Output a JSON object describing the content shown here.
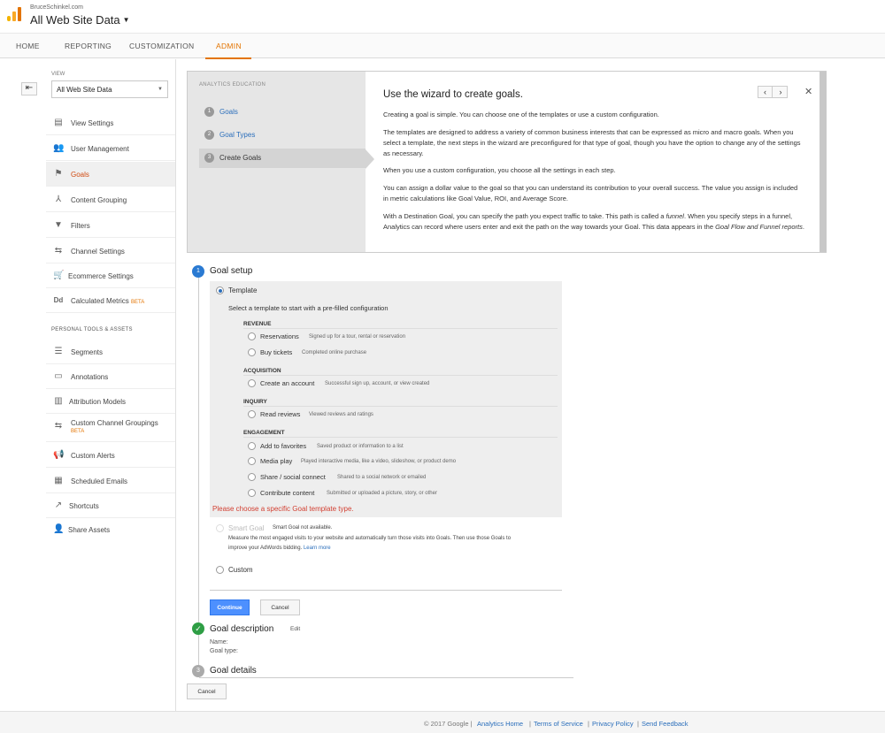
{
  "header": {
    "account_email": "BruceSchinkel.com",
    "property": "All Web Site Data",
    "caret": "▼"
  },
  "tabs": [
    "HOME",
    "REPORTING",
    "CUSTOMIZATION",
    "ADMIN"
  ],
  "sidebar": {
    "back": "⇤",
    "view_label": "VIEW",
    "view_value": "All Web Site Data",
    "view_caret": "▼",
    "items": [
      {
        "label": "View Settings",
        "icon": "document-icon"
      },
      {
        "label": "User Management",
        "icon": "users-icon"
      },
      {
        "label": "Goals",
        "icon": "flag-icon"
      },
      {
        "label": "Content Grouping",
        "icon": "person-icon"
      },
      {
        "label": "Filters",
        "icon": "filter-icon"
      },
      {
        "label": "Channel Settings",
        "icon": "channel-icon"
      },
      {
        "label": "Ecommerce Settings",
        "icon": "cart-icon"
      },
      {
        "label": "Calculated Metrics",
        "beta": "BETA",
        "icon": "dd-icon"
      }
    ],
    "personal_head": "PERSONAL TOOLS & ASSETS",
    "personal_items": [
      {
        "label": "Segments",
        "icon": "segments-icon"
      },
      {
        "label": "Annotations",
        "icon": "annotation-icon"
      },
      {
        "label": "Attribution Models",
        "icon": "bar-chart-icon"
      },
      {
        "label": "Custom Channel Groupings",
        "beta": "BETA",
        "icon": "channel-icon"
      },
      {
        "label": "Custom Alerts",
        "icon": "megaphone-icon"
      },
      {
        "label": "Scheduled Emails",
        "icon": "calendar-icon"
      },
      {
        "label": "Shortcuts",
        "icon": "shortcut-icon"
      },
      {
        "label": "Share Assets",
        "icon": "share-icon"
      }
    ]
  },
  "education": {
    "heading": "ANALYTICS EDUCATION",
    "steps": [
      {
        "num": "1",
        "label": "Goals"
      },
      {
        "num": "2",
        "label": "Goal Types"
      },
      {
        "num": "3",
        "label": "Create Goals"
      }
    ],
    "title": "Use the wizard to create goals.",
    "prev": "‹",
    "next": "›",
    "close": "✕",
    "p1": "Creating a goal is simple. You can choose one of the templates or use a custom configuration.",
    "p2": "The templates are designed to address a variety of common business interests that can be expressed as micro and macro goals. When you select a template, the next steps in the wizard are preconfigured for that type of goal, though you have the option to change any of the settings as necessary.",
    "p3": "When you use a custom configuration, you choose all the settings in each step.",
    "p4": "You can assign a dollar value to the goal so that you can understand its contribution to your overall success. The value you assign is included in metric calculations like Goal Value, ROI, and Average Score.",
    "p5a": "With a Destination Goal, you can specify the path you expect traffic to take. This path is called a",
    "p5b": "funnel",
    "p5c": ". When you specify steps in a funnel, Analytics can record where users enter and exit the path on the way towards your Goal. This data appears in the",
    "p5d": "Goal Flow and Funnel reports",
    "p5e": "."
  },
  "goal_setup": {
    "num": "1",
    "title": "Goal setup",
    "template_label": "Template",
    "template_hint": "Select a template to start with a pre-filled configuration",
    "categories": [
      {
        "name": "REVENUE",
        "options": [
          {
            "label": "Reservations",
            "desc": "Signed up for a tour, rental or reservation"
          },
          {
            "label": "Buy tickets",
            "desc": "Completed online purchase"
          }
        ]
      },
      {
        "name": "ACQUISITION",
        "options": [
          {
            "label": "Create an account",
            "desc": "Successful sign up, account, or view created"
          }
        ]
      },
      {
        "name": "INQUIRY",
        "options": [
          {
            "label": "Read reviews",
            "desc": "Viewed reviews and ratings"
          }
        ]
      },
      {
        "name": "ENGAGEMENT",
        "options": [
          {
            "label": "Add to favorites",
            "desc": "Saved product or information to a list"
          },
          {
            "label": "Media play",
            "desc": "Played interactive media, like a video, slideshow, or product demo"
          },
          {
            "label": "Share / social connect",
            "desc": "Shared to a social network or emailed"
          },
          {
            "label": "Contribute content",
            "desc": "Submitted or uploaded a picture, story, or other"
          }
        ]
      }
    ],
    "error": "Please choose a specific Goal template type.",
    "smart_label": "Smart Goal",
    "smart_status": "Smart Goal not available.",
    "smart_desc1": "Measure the most engaged visits to your website and automatically turn those visits into Goals. Then use those Goals to",
    "smart_desc2": "improve your AdWords bidding.",
    "learn_more": "Learn more",
    "custom_label": "Custom",
    "continue": "Continue",
    "cancel": "Cancel"
  },
  "goal_description": {
    "check": "✓",
    "title": "Goal description",
    "edit": "Edit",
    "name_label": "Name:",
    "type_label": "Goal type:"
  },
  "goal_details": {
    "num": "3",
    "title": "Goal details"
  },
  "bottom_cancel": "Cancel",
  "footer": {
    "copyright": "© 2017 Google |",
    "home": "Analytics Home",
    "sep1": "|",
    "terms": "Terms of Service",
    "sep2": "|",
    "privacy": "Privacy Policy",
    "sep3": "|",
    "feedback": "Send Feedback"
  },
  "colors": {
    "accent": "#e37400",
    "link": "#2a6ebb",
    "error": "#d23f31",
    "primary_button": "#4d90fe",
    "success": "#0f9d58"
  }
}
